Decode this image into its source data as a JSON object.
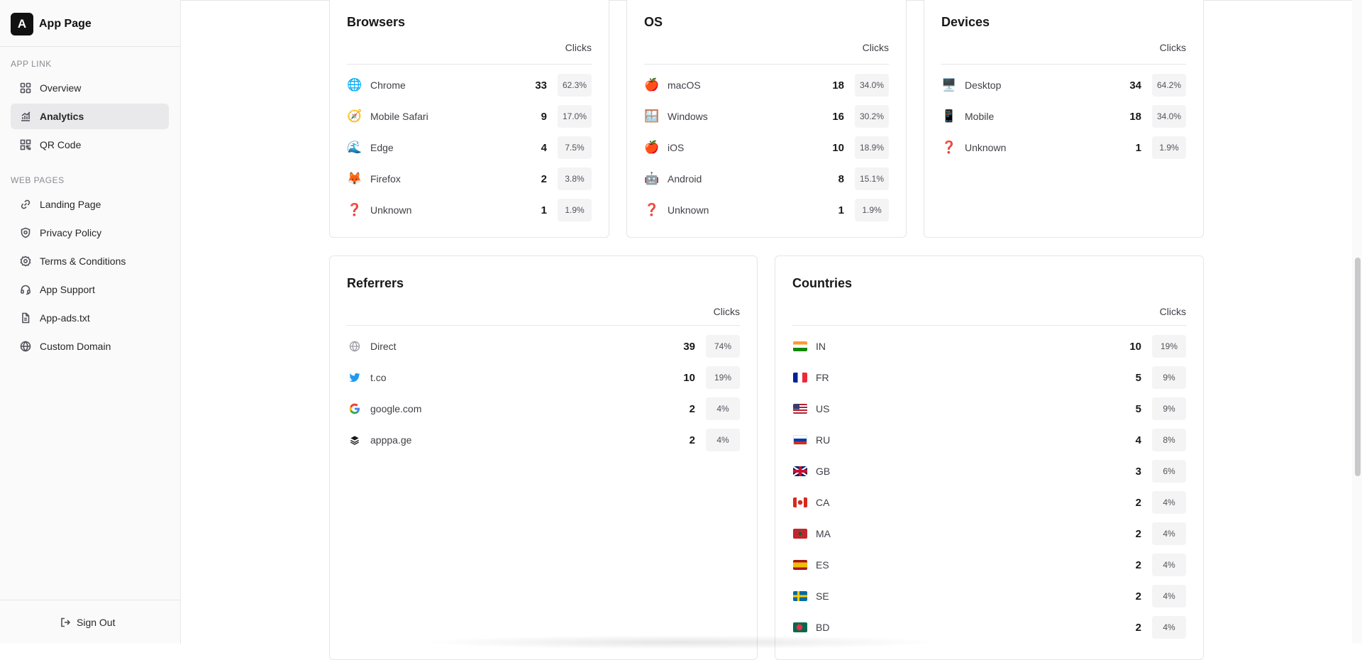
{
  "app": {
    "logo_letter": "A",
    "title": "App Page"
  },
  "sidebar": {
    "section_app_link": "APP LINK",
    "section_web_pages": "WEB PAGES",
    "items": [
      {
        "label": "Overview",
        "icon": "grid-icon"
      },
      {
        "label": "Analytics",
        "icon": "chart-icon",
        "active": true
      },
      {
        "label": "QR Code",
        "icon": "qr-icon"
      },
      {
        "label": "Landing Page",
        "icon": "link-icon"
      },
      {
        "label": "Privacy Policy",
        "icon": "shield-icon"
      },
      {
        "label": "Terms & Conditions",
        "icon": "badge-icon"
      },
      {
        "label": "App Support",
        "icon": "headset-icon"
      },
      {
        "label": "App-ads.txt",
        "icon": "file-icon"
      },
      {
        "label": "Custom Domain",
        "icon": "globe-icon"
      }
    ],
    "sign_out": "Sign Out"
  },
  "clicks_label": "Clicks",
  "browsers": {
    "title": "Browsers",
    "rows": [
      {
        "icon": "🌐",
        "label": "Chrome",
        "count": "33",
        "pct": "62.3%"
      },
      {
        "icon": "🧭",
        "label": "Mobile Safari",
        "count": "9",
        "pct": "17.0%"
      },
      {
        "icon": "🌊",
        "label": "Edge",
        "count": "4",
        "pct": "7.5%"
      },
      {
        "icon": "🦊",
        "label": "Firefox",
        "count": "2",
        "pct": "3.8%"
      },
      {
        "icon": "❓",
        "label": "Unknown",
        "count": "1",
        "pct": "1.9%"
      }
    ]
  },
  "os": {
    "title": "OS",
    "rows": [
      {
        "icon": "🍎",
        "label": "macOS",
        "count": "18",
        "pct": "34.0%"
      },
      {
        "icon": "🪟",
        "label": "Windows",
        "count": "16",
        "pct": "30.2%"
      },
      {
        "icon": "🍎",
        "label": "iOS",
        "count": "10",
        "pct": "18.9%"
      },
      {
        "icon": "🤖",
        "label": "Android",
        "count": "8",
        "pct": "15.1%"
      },
      {
        "icon": "❓",
        "label": "Unknown",
        "count": "1",
        "pct": "1.9%"
      }
    ]
  },
  "devices": {
    "title": "Devices",
    "rows": [
      {
        "icon": "🖥️",
        "label": "Desktop",
        "count": "34",
        "pct": "64.2%"
      },
      {
        "icon": "📱",
        "label": "Mobile",
        "count": "18",
        "pct": "34.0%"
      },
      {
        "icon": "❓",
        "label": "Unknown",
        "count": "1",
        "pct": "1.9%"
      }
    ]
  },
  "referrers": {
    "title": "Referrers",
    "rows": [
      {
        "label": "Direct",
        "count": "39",
        "pct": "74%"
      },
      {
        "label": "t.co",
        "count": "10",
        "pct": "19%"
      },
      {
        "label": "google.com",
        "count": "2",
        "pct": "4%"
      },
      {
        "label": "apppa.ge",
        "count": "2",
        "pct": "4%"
      }
    ]
  },
  "countries": {
    "title": "Countries",
    "rows": [
      {
        "label": "IN",
        "count": "10",
        "pct": "19%"
      },
      {
        "label": "FR",
        "count": "5",
        "pct": "9%"
      },
      {
        "label": "US",
        "count": "5",
        "pct": "9%"
      },
      {
        "label": "RU",
        "count": "4",
        "pct": "8%"
      },
      {
        "label": "GB",
        "count": "3",
        "pct": "6%"
      },
      {
        "label": "CA",
        "count": "2",
        "pct": "4%"
      },
      {
        "label": "MA",
        "count": "2",
        "pct": "4%"
      },
      {
        "label": "ES",
        "count": "2",
        "pct": "4%"
      },
      {
        "label": "SE",
        "count": "2",
        "pct": "4%"
      },
      {
        "label": "BD",
        "count": "2",
        "pct": "4%"
      }
    ]
  }
}
